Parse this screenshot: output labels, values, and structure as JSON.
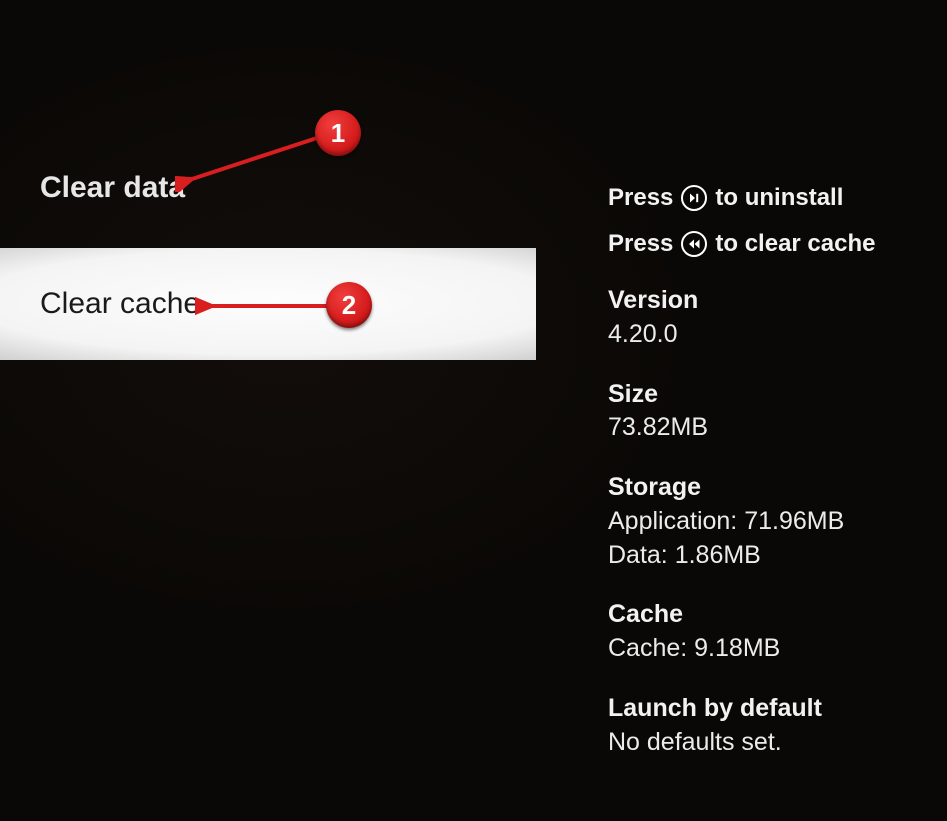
{
  "menu": {
    "clear_data": "Clear data",
    "clear_cache": "Clear cache"
  },
  "hints": {
    "uninstall_pre": "Press",
    "uninstall_post": "to uninstall",
    "clearcache_pre": "Press",
    "clearcache_post": "to clear cache"
  },
  "info": {
    "version_label": "Version",
    "version_value": "4.20.0",
    "size_label": "Size",
    "size_value": "73.82MB",
    "storage_label": "Storage",
    "storage_app": "Application: 71.96MB",
    "storage_data": "Data: 1.86MB",
    "cache_label": "Cache",
    "cache_value": "Cache: 9.18MB",
    "launch_label": "Launch by default",
    "launch_value": "No defaults set."
  },
  "annotations": {
    "badge1": "1",
    "badge2": "2"
  }
}
